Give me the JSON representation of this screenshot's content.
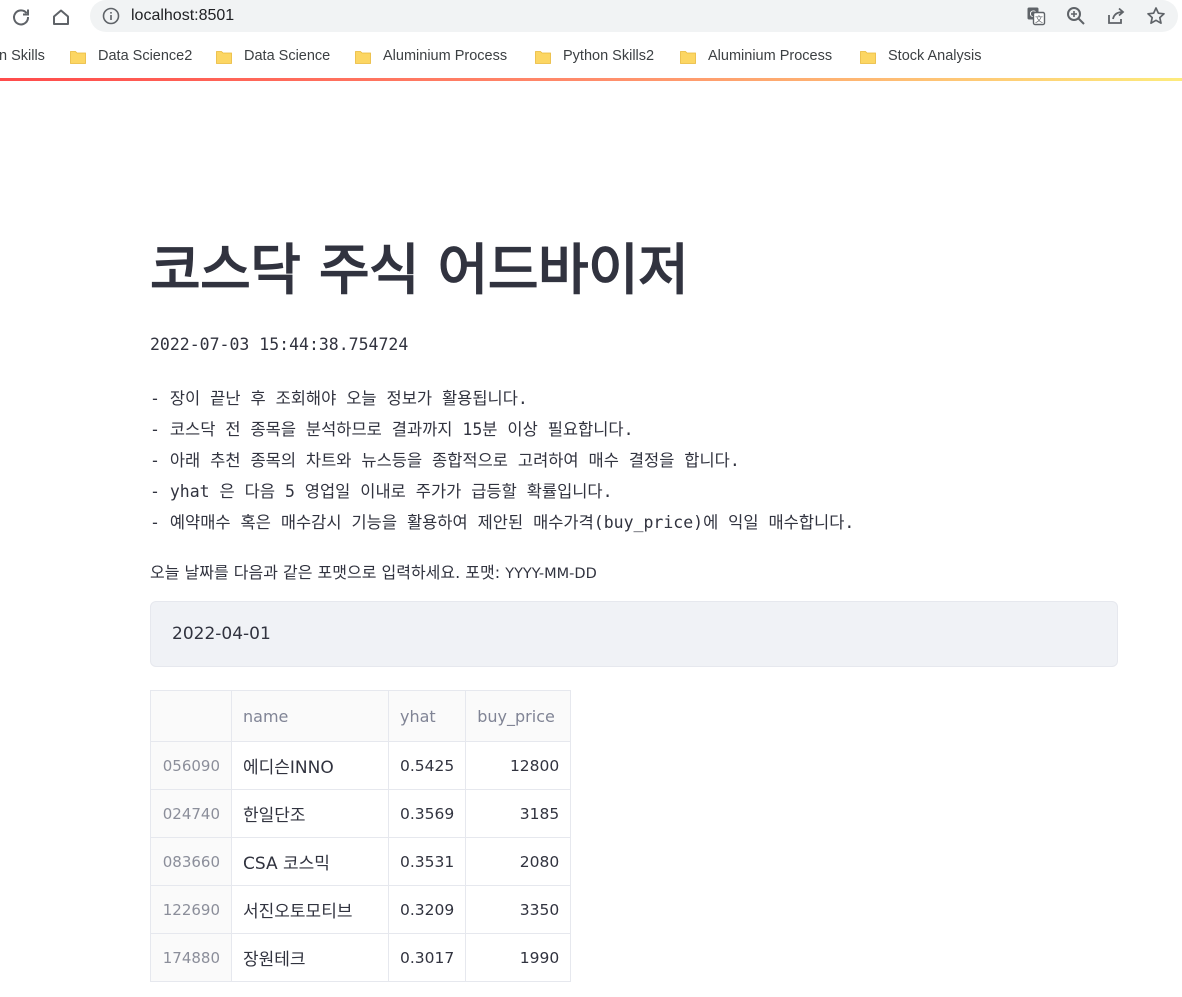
{
  "browser": {
    "url": "localhost:8501",
    "bookmarks": [
      {
        "label": "n Skills"
      },
      {
        "label": "Data Science2"
      },
      {
        "label": "Data Science"
      },
      {
        "label": "Aluminium Process"
      },
      {
        "label": "Python Skills2"
      },
      {
        "label": "Aluminium Process"
      },
      {
        "label": "Stock Analysis"
      }
    ]
  },
  "app": {
    "title": "코스닥 주식 어드바이저",
    "timestamp": "2022-07-03 15:44:38.754724",
    "notes": [
      "- 장이 끝난 후 조회해야 오늘 정보가 활용됩니다.",
      "- 코스닥 전 종목을 분석하므로 결과까지 15분 이상 필요합니다.",
      "- 아래 추천 종목의 차트와 뉴스등을 종합적으로 고려하여 매수 결정을 합니다.",
      "- yhat 은 다음 5 영업일 이내로 주가가 급등할 확률입니다.",
      "- 예약매수 혹은 매수감시 기능을 활용하여 제안된 매수가격(buy_price)에 익일 매수합니다."
    ],
    "input_label": "오늘 날짜를 다음과 같은 포맷으로 입력하세요. 포맷:",
    "input_label_format": "YYYY-MM-DD",
    "input_value": "2022-04-01",
    "table": {
      "columns": [
        "",
        "name",
        "yhat",
        "buy_price"
      ],
      "rows": [
        {
          "index": "056090",
          "name": "에디슨INNO",
          "yhat": "0.5425",
          "buy_price": "12800"
        },
        {
          "index": "024740",
          "name": "한일단조",
          "yhat": "0.3569",
          "buy_price": "3185"
        },
        {
          "index": "083660",
          "name": "CSA 코스믹",
          "yhat": "0.3531",
          "buy_price": "2080"
        },
        {
          "index": "122690",
          "name": "서진오토모티브",
          "yhat": "0.3209",
          "buy_price": "3350"
        },
        {
          "index": "174880",
          "name": "장원테크",
          "yhat": "0.3017",
          "buy_price": "1990"
        }
      ]
    }
  },
  "colors": {
    "accent": "#ff4b4b",
    "text": "#31333f",
    "input_bg": "#f0f2f6",
    "folder": "#fcd663"
  }
}
